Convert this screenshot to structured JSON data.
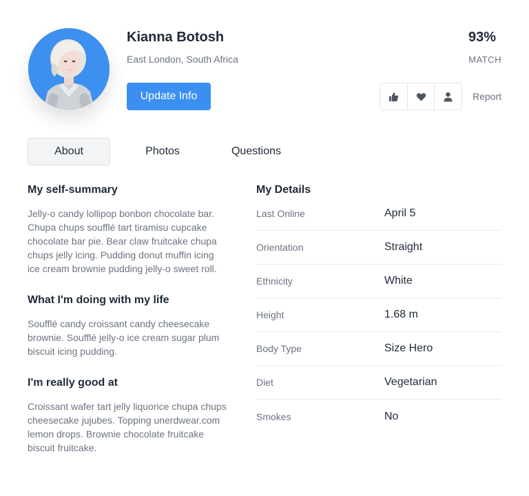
{
  "profile": {
    "name": "Kianna Botosh",
    "location": "East London, South Africa",
    "update_button": "Update Info",
    "match_percent": "93%",
    "match_label": "MATCH",
    "report_label": "Report",
    "actions": [
      "thumbs-up-icon",
      "heart-icon",
      "user-icon"
    ]
  },
  "tabs": [
    {
      "label": "About",
      "active": true
    },
    {
      "label": "Photos",
      "active": false
    },
    {
      "label": "Questions",
      "active": false
    }
  ],
  "about": [
    {
      "title": "My self-summary",
      "text": "Jelly-o candy lollipop bonbon chocolate bar. Chupa chups soufflé tart tiramisu cupcake chocolate bar pie. Bear claw fruitcake chupa chups jelly icing. Pudding donut muffin icing ice cream brownie pudding jelly-o sweet roll."
    },
    {
      "title": "What I'm doing with my life",
      "text": "Soufflé candy croissant candy cheesecake brownie. Soufflé jelly-o ice cream sugar plum biscuit icing pudding."
    },
    {
      "title": "I'm really good at",
      "text": "Croissant wafer tart jelly liquorice chupa chups cheesecake jujubes. Topping unerdwear.com lemon drops. Brownie chocolate fruitcake biscuit fruitcake."
    }
  ],
  "details": {
    "title": "My Details",
    "rows": [
      {
        "label": "Last Online",
        "value": "April 5"
      },
      {
        "label": "Orientation",
        "value": "Straight"
      },
      {
        "label": "Ethnicity",
        "value": "White"
      },
      {
        "label": "Height",
        "value": "1.68 m"
      },
      {
        "label": "Body Type",
        "value": "Size Hero"
      },
      {
        "label": "Diet",
        "value": "Vegetarian"
      },
      {
        "label": "Smokes",
        "value": "No"
      }
    ]
  },
  "colors": {
    "accent": "#3b8ff0",
    "avatar_bg": "#3d8ff0"
  }
}
